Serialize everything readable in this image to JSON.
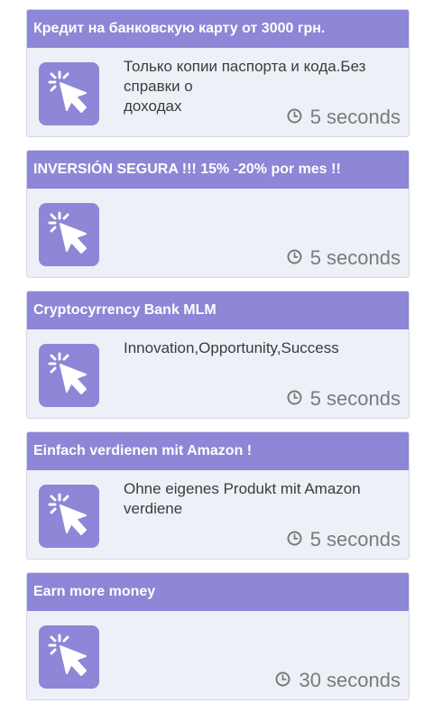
{
  "offers": [
    {
      "title": "Кредит на банковскую карту от 3000 грн.",
      "description_lines": [
        "Только копии паспорта и кода.Без",
        "справки о",
        "доходах"
      ],
      "timer": "5 seconds"
    },
    {
      "title": "INVERSIÓN SEGURA !!! 15% -20% por mes !!",
      "description_lines": [],
      "timer": "5 seconds"
    },
    {
      "title": "Cryptocyrrency Bank MLM",
      "description_lines": [
        "Innovation,Opportunity,Success"
      ],
      "timer": "5 seconds"
    },
    {
      "title": "Einfach verdienen mit Amazon !",
      "description_lines": [
        "Ohne eigenes Produkt mit Amazon",
        "verdiene"
      ],
      "timer": "5 seconds"
    },
    {
      "title": "Earn more money",
      "description_lines": [],
      "timer": "30 seconds"
    }
  ],
  "icons": {
    "offer": "pointer-click-icon",
    "timer": "clock-icon"
  },
  "colors": {
    "accent": "#8e86d6",
    "card_background": "#eef0f8",
    "card_border": "#d4d8e8",
    "text": "#3c3c3c",
    "timer_text": "#7a7a7a"
  }
}
